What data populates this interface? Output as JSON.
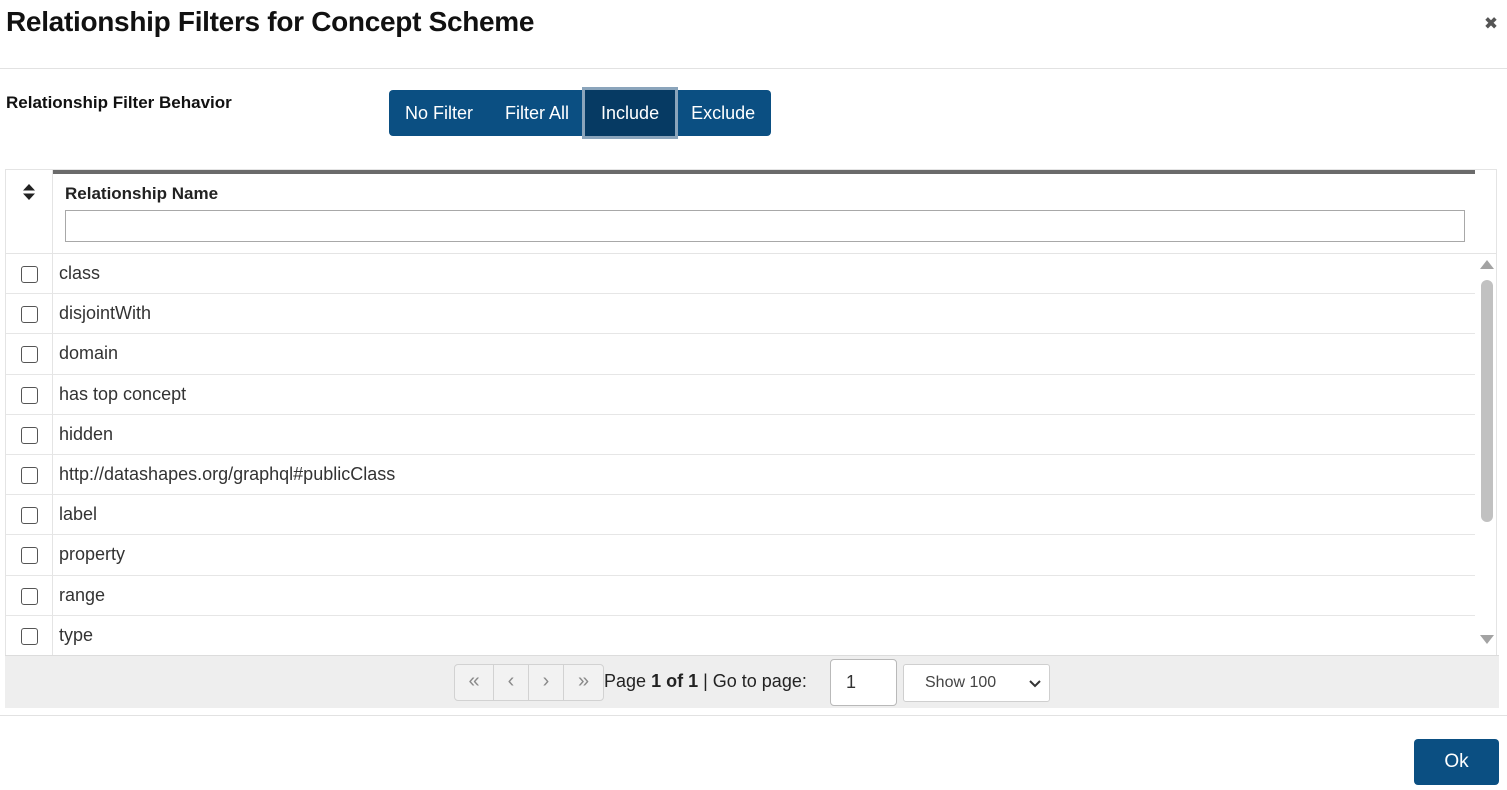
{
  "dialog": {
    "title": "Relationship Filters for Concept Scheme",
    "close_icon": "close-icon"
  },
  "behavior": {
    "label": "Relationship Filter Behavior",
    "options": [
      "No Filter",
      "Filter All",
      "Include",
      "Exclude"
    ],
    "selected": "Include"
  },
  "table": {
    "column_header": "Relationship Name",
    "filter_value": "",
    "rows": [
      {
        "name": "class",
        "checked": false
      },
      {
        "name": "disjointWith",
        "checked": false
      },
      {
        "name": "domain",
        "checked": false
      },
      {
        "name": "has top concept",
        "checked": false
      },
      {
        "name": "hidden",
        "checked": false
      },
      {
        "name": "http://datashapes.org/graphql#publicClass",
        "checked": false
      },
      {
        "name": "label",
        "checked": false
      },
      {
        "name": "property",
        "checked": false
      },
      {
        "name": "range",
        "checked": false
      },
      {
        "name": "type",
        "checked": false
      }
    ]
  },
  "pagination": {
    "page_word": "Page",
    "page_current": "1 of 1",
    "goto_label": "| Go to page:",
    "goto_value": "1",
    "page_size_label": "Show 100"
  },
  "footer": {
    "ok_label": "Ok"
  },
  "colors": {
    "primary": "#0b4f82",
    "primary_active": "#063a63"
  }
}
